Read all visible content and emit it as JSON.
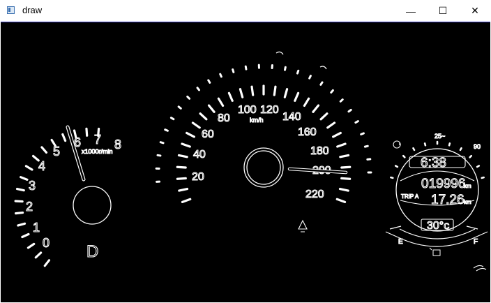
{
  "window": {
    "title": "draw",
    "minimize_glyph": "—",
    "maximize_glyph": "☐",
    "close_glyph": "✕"
  },
  "tachometer": {
    "ticks": [
      "0",
      "1",
      "2",
      "3",
      "4",
      "5",
      "6",
      "7",
      "8"
    ],
    "unit": "x1000r/min",
    "gear": "D"
  },
  "speedometer": {
    "ticks": [
      "20",
      "40",
      "60",
      "80",
      "100",
      "120",
      "140",
      "160",
      "180",
      "200",
      "220"
    ],
    "unit": "km/h"
  },
  "info_panel": {
    "clock": "6:38",
    "odometer": "019996",
    "odometer_unit": "km",
    "trip_label": "TRIP A",
    "trip_value": "17.26",
    "trip_unit": "km",
    "temperature": "30°c",
    "temp_scale_mid": "25~",
    "temp_scale_right": "90",
    "fuel_empty": "E",
    "fuel_full": "F"
  }
}
